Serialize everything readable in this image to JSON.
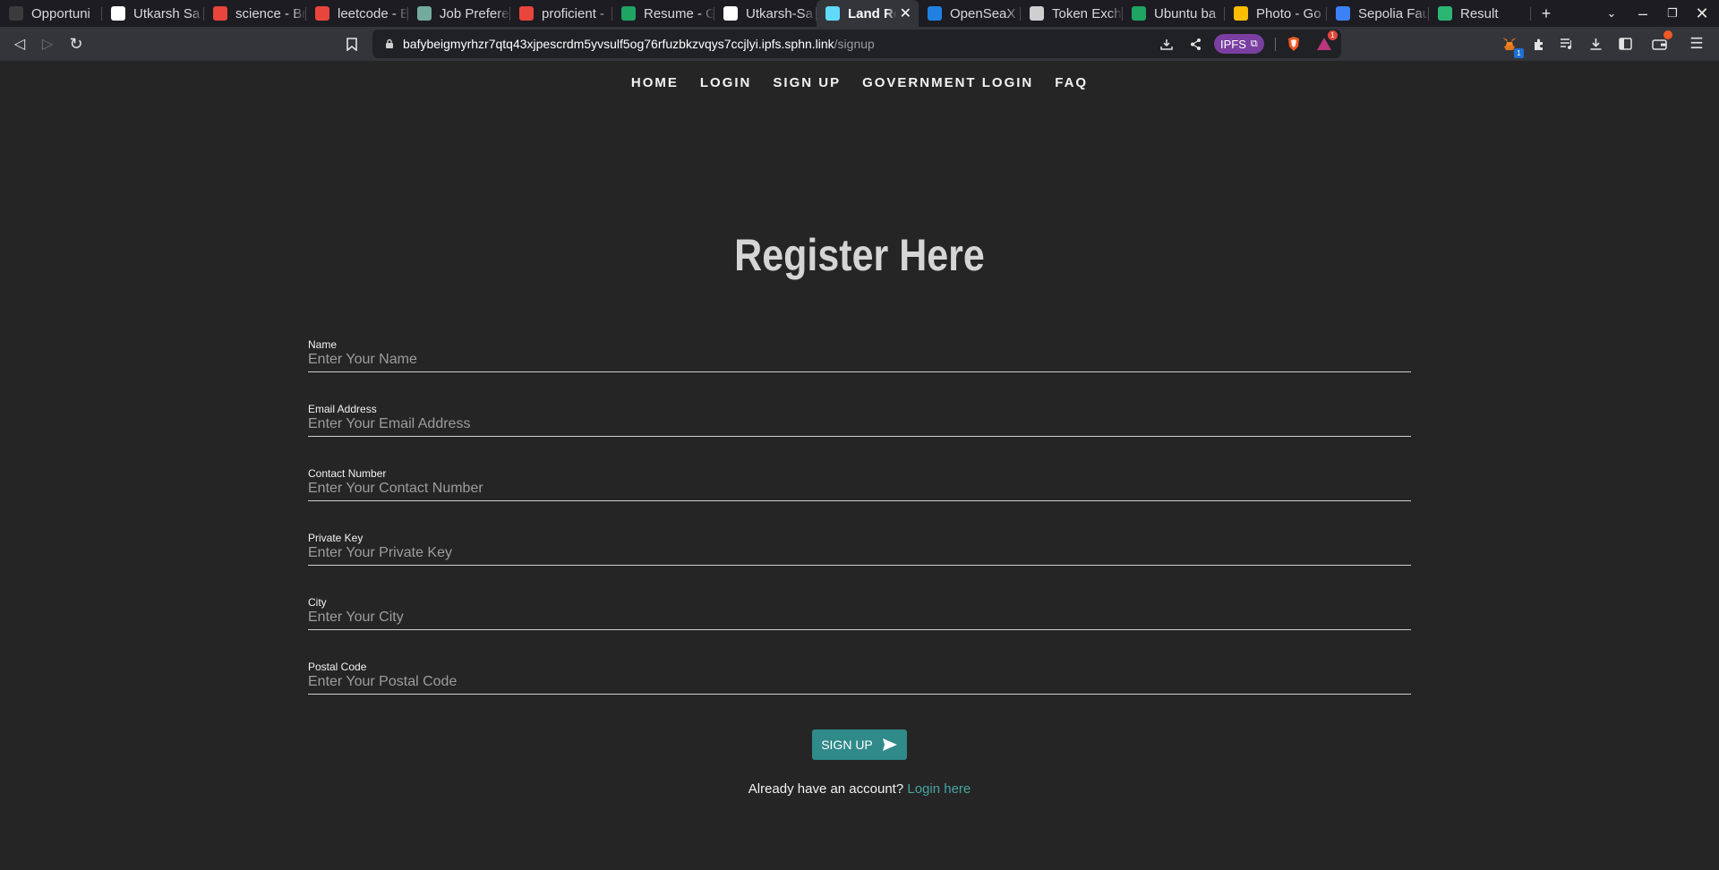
{
  "browser": {
    "tabs": [
      {
        "title": "Opportuni",
        "icon": "unstop-icon",
        "color": "#3b3b3b"
      },
      {
        "title": "Utkarsh Sa",
        "icon": "web-icon",
        "color": "#ffffff"
      },
      {
        "title": "science - Br",
        "icon": "brave-search-icon",
        "color": "#e8453c"
      },
      {
        "title": "leetcode - B",
        "icon": "brave-search-icon",
        "color": "#e8453c"
      },
      {
        "title": "Job Prefere",
        "icon": "chatgpt-icon",
        "color": "#74aa9c"
      },
      {
        "title": "proficient -",
        "icon": "brave-search-icon",
        "color": "#e8453c"
      },
      {
        "title": "Resume - G",
        "icon": "google-drive-icon",
        "color": "#1fa463"
      },
      {
        "title": "Utkarsh-Sa",
        "icon": "github-icon",
        "color": "#ffffff"
      },
      {
        "title": "Land Re",
        "icon": "react-icon",
        "color": "#61dafb",
        "active": true
      },
      {
        "title": "OpenSeaX",
        "icon": "opensea-icon",
        "color": "#2081e2"
      },
      {
        "title": "Token Exch",
        "icon": "globe-icon",
        "color": "#cfcfcf"
      },
      {
        "title": "Ubuntu ba",
        "icon": "google-drive-icon",
        "color": "#1fa463"
      },
      {
        "title": "Photo - Go",
        "icon": "google-photos-icon",
        "color": "#fbbc04"
      },
      {
        "title": "Sepolia Fau",
        "icon": "alchemy-icon",
        "color": "#3b82f6"
      },
      {
        "title": "Result",
        "icon": "play-icon",
        "color": "#2bb673"
      }
    ],
    "url_host": "bafybeigmyrhzr7qtq43xjpescrdm5yvsulf5og76rfuzbkzvqys7ccjlyi.ipfs.sphn.link",
    "url_path": "/signup",
    "ipfs_label": "IPFS",
    "notification_count": "1",
    "extension_badge": "1"
  },
  "nav": {
    "items": [
      "HOME",
      "LOGIN",
      "SIGN UP",
      "GOVERNMENT LOGIN",
      "FAQ"
    ]
  },
  "form": {
    "title": "Register Here",
    "fields": [
      {
        "label": "Name",
        "placeholder": "Enter Your Name"
      },
      {
        "label": "Email Address",
        "placeholder": "Enter Your Email Address"
      },
      {
        "label": "Contact Number",
        "placeholder": "Enter Your Contact Number"
      },
      {
        "label": "Private Key",
        "placeholder": "Enter Your Private Key"
      },
      {
        "label": "City",
        "placeholder": "Enter Your City"
      },
      {
        "label": "Postal Code",
        "placeholder": "Enter Your Postal Code"
      }
    ],
    "submit_label": "SIGN UP",
    "already_text": "Already have an account?",
    "login_link": "Login here"
  },
  "colors": {
    "background": "#252525",
    "accent": "#2f8a89",
    "link": "#45a3a2"
  }
}
